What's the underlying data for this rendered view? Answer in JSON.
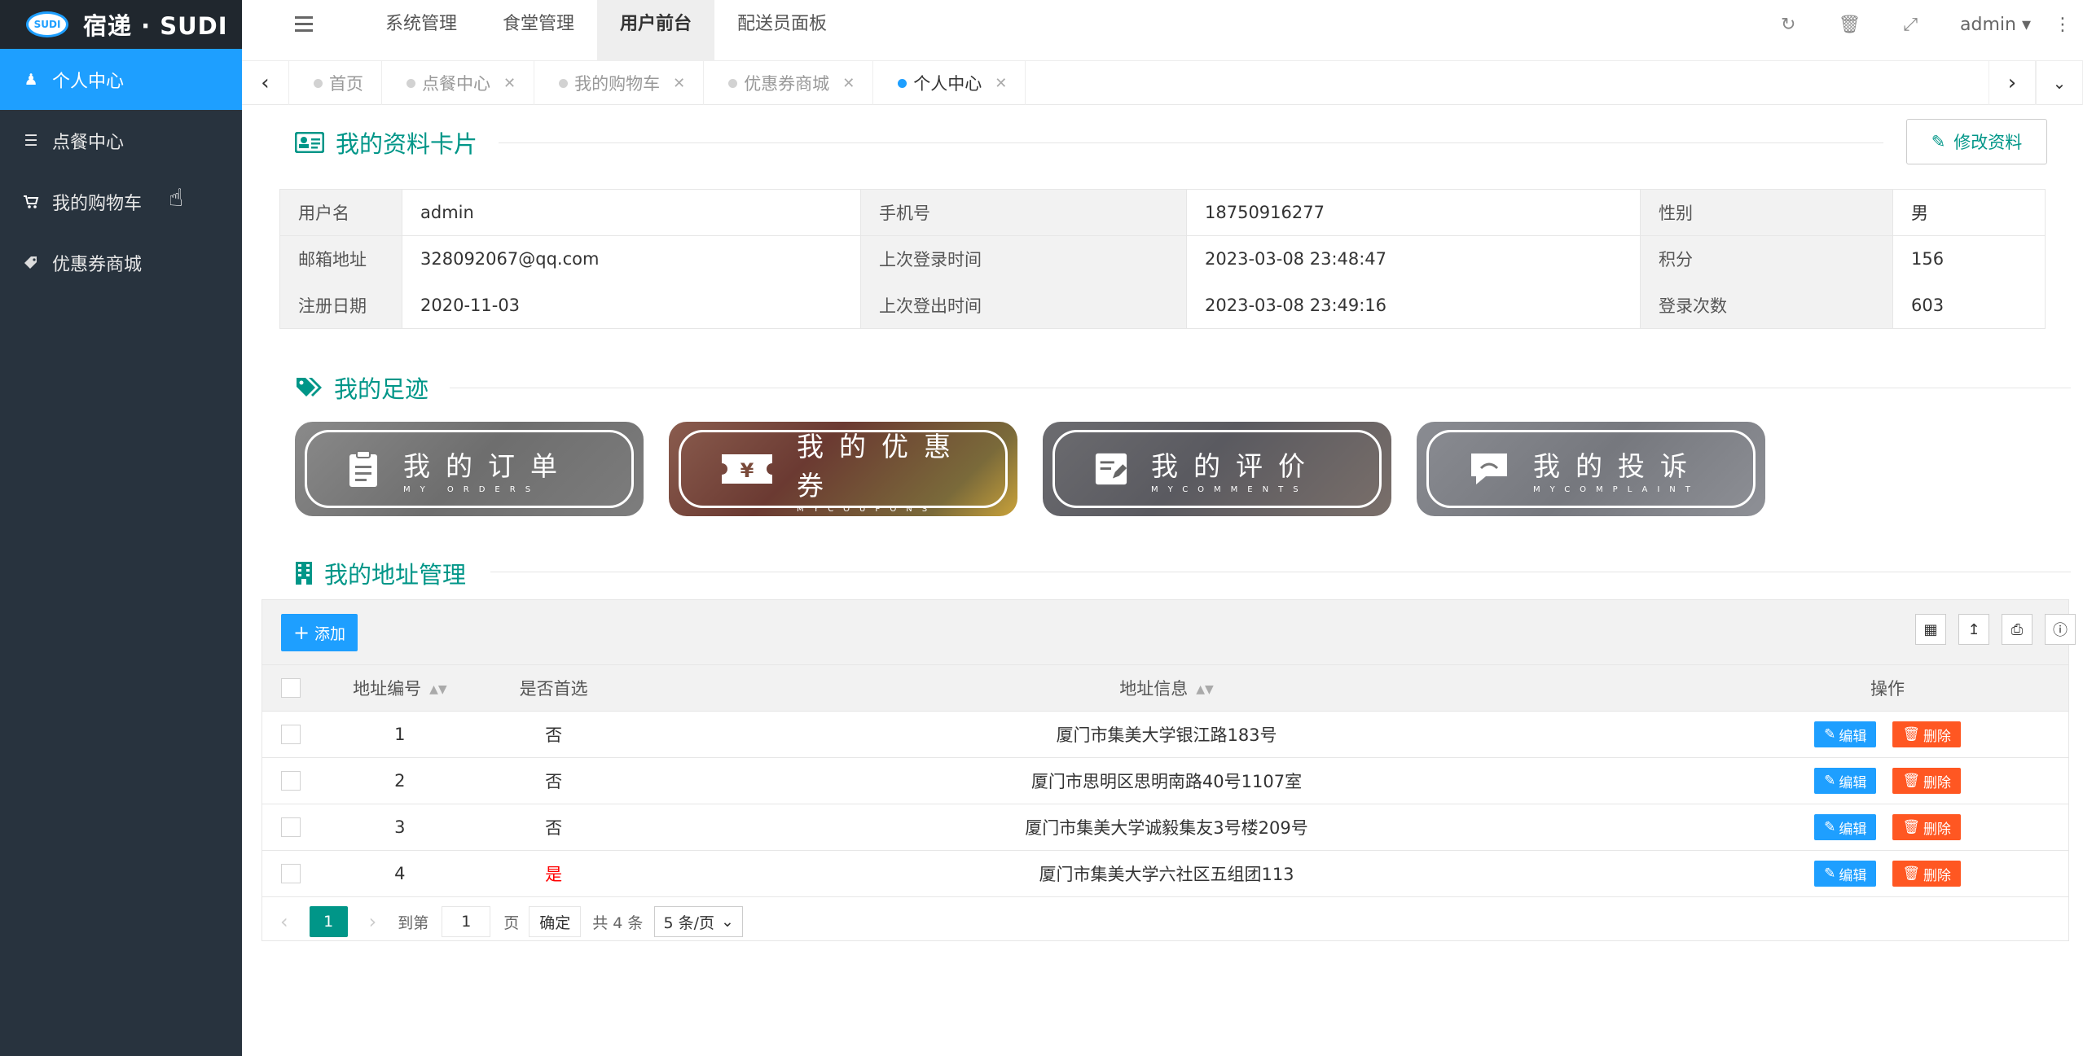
{
  "brand": {
    "badge": "SUDI",
    "name": "宿递 · SUDI"
  },
  "sidebar": {
    "items": [
      {
        "label": "个人中心",
        "icon": "user-icon"
      },
      {
        "label": "点餐中心",
        "icon": "list-icon"
      },
      {
        "label": "我的购物车",
        "icon": "cart-icon"
      },
      {
        "label": "优惠券商城",
        "icon": "tag-icon"
      }
    ]
  },
  "topnav": {
    "items": [
      "系统管理",
      "食堂管理",
      "用户前台",
      "配送员面板"
    ],
    "user": "admin"
  },
  "tabs": [
    "首页",
    "点餐中心",
    "我的购物车",
    "优惠券商城",
    "个人中心"
  ],
  "profile": {
    "title": "我的资料卡片",
    "edit_label": "修改资料",
    "rows": [
      [
        "用户名",
        "admin",
        "手机号",
        "18750916277",
        "性别",
        "男"
      ],
      [
        "邮箱地址",
        "328092067@qq.com",
        "上次登录时间",
        "2023-03-08 23:48:47",
        "积分",
        "156"
      ],
      [
        "注册日期",
        "2020-11-03",
        "上次登出时间",
        "2023-03-08 23:49:16",
        "登录次数",
        "603"
      ]
    ]
  },
  "footprint": {
    "title": "我的足迹",
    "tiles": [
      {
        "cn": "我的订单",
        "en": "MY ORDERS",
        "icon": "clipboard-icon"
      },
      {
        "cn": "我的优惠券",
        "en": "MYCOUPONS",
        "icon": "coupon-icon"
      },
      {
        "cn": "我的评价",
        "en": "MYCOMMENTS",
        "icon": "edit-note-icon"
      },
      {
        "cn": "我的投诉",
        "en": "MYCOMPLAINT",
        "icon": "chat-icon"
      }
    ]
  },
  "address": {
    "title": "我的地址管理",
    "add_label": "添加",
    "headers": {
      "id": "地址编号",
      "first": "是否首选",
      "addr": "地址信息",
      "op": "操作"
    },
    "edit_label": "编辑",
    "delete_label": "删除",
    "rows": [
      {
        "id": "1",
        "first": "否",
        "addr": "厦门市集美大学银江路183号"
      },
      {
        "id": "2",
        "first": "否",
        "addr": "厦门市思明区思明南路40号1107室"
      },
      {
        "id": "3",
        "first": "否",
        "addr": "厦门市集美大学诚毅集友3号楼209号"
      },
      {
        "id": "4",
        "first": "是",
        "addr": "厦门市集美大学六社区五组团113"
      }
    ],
    "pager": {
      "current": "1",
      "goto_label": "到第",
      "page_input": "1",
      "page_unit": "页",
      "confirm": "确定",
      "total": "共 4 条",
      "per_page": "5 条/页"
    }
  },
  "colors": {
    "sidebar": "#28333e",
    "accent": "#1e9fff",
    "teal": "#009688",
    "danger": "#ff5722"
  }
}
